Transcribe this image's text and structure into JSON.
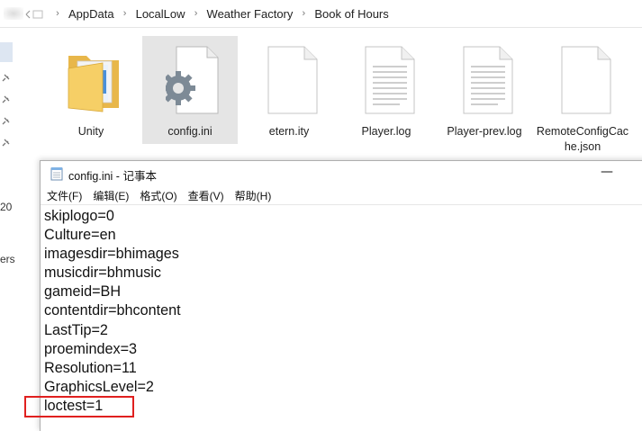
{
  "explorer": {
    "breadcrumbs": [
      "AppData",
      "LocalLow",
      "Weather Factory",
      "Book of Hours"
    ],
    "sidebar_text": [
      "20",
      "ers"
    ],
    "files": [
      {
        "name": "Unity",
        "icon": "folder-icon"
      },
      {
        "name": "config.ini",
        "icon": "settings-file-icon",
        "selected": true
      },
      {
        "name": "etern.ity",
        "icon": "blank-file-icon"
      },
      {
        "name": "Player.log",
        "icon": "text-file-icon"
      },
      {
        "name": "Player-prev.log",
        "icon": "text-file-icon"
      },
      {
        "name": "RemoteConfigCache.json",
        "icon": "blank-file-icon"
      }
    ]
  },
  "notepad": {
    "title": "config.ini - 记事本",
    "minimize_glyph": "—",
    "menu": [
      "文件(F)",
      "编辑(E)",
      "格式(O)",
      "查看(V)",
      "帮助(H)"
    ],
    "lines": [
      "skiplogo=0",
      "Culture=en",
      "imagesdir=bhimages",
      "musicdir=bhmusic",
      "gameid=BH",
      "contentdir=bhcontent",
      "LastTip=2",
      "proemindex=3",
      "Resolution=11",
      "GraphicsLevel=2",
      "loctest=1"
    ],
    "highlight_color": "#e0201f"
  }
}
